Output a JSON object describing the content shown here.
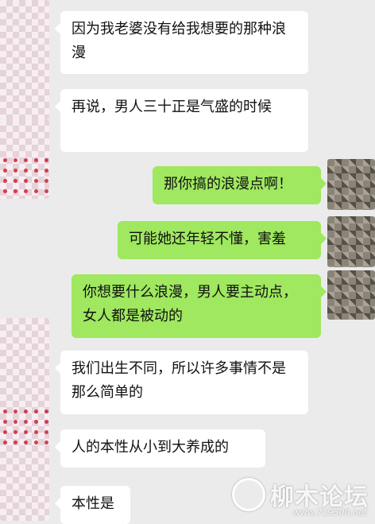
{
  "messages": [
    {
      "side": "left",
      "text": "因为我老婆没有给我想要的那种浪漫"
    },
    {
      "side": "left",
      "text": "再说，男人三十正是气盛的时候"
    },
    {
      "side": "right",
      "text": "那你搞的浪漫点啊！"
    },
    {
      "side": "right",
      "text": "可能她还年轻不懂，害羞"
    },
    {
      "side": "right",
      "text": "你想要什么浪漫，男人要主动点，女人都是被动的"
    },
    {
      "side": "left",
      "text": "我们出生不同，所以许多事情不是那么简单的"
    },
    {
      "side": "left",
      "text": "人的本性从小到大养成的"
    },
    {
      "side": "left",
      "text": "本性是"
    }
  ],
  "watermark": {
    "title": "柳木论坛",
    "url": "www.719300.net"
  }
}
